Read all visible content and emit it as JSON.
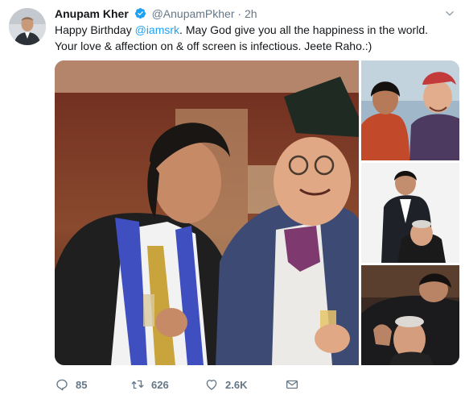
{
  "tweet": {
    "author": {
      "name": "Anupam Kher",
      "handle": "@AnupamPkher",
      "separator": "·",
      "time": "2h"
    },
    "text": {
      "line1_prefix": "Happy Birthday ",
      "mention": "@iamsrk",
      "line1_suffix": ". May God give you all the happiness in the world.",
      "line2": "Your love & affection on & off screen is infectious. Jeete Raho.:)"
    },
    "actions": {
      "replies": "85",
      "retweets": "626",
      "likes": "2.6K"
    }
  },
  "icons": {
    "verified": "verified-badge-icon",
    "caret": "chevron-down-icon",
    "reply": "reply-icon",
    "retweet": "retweet-icon",
    "like": "heart-icon",
    "message": "envelope-icon"
  },
  "colors": {
    "accent": "#1da1f2",
    "muted": "#657786",
    "text": "#14171a"
  }
}
